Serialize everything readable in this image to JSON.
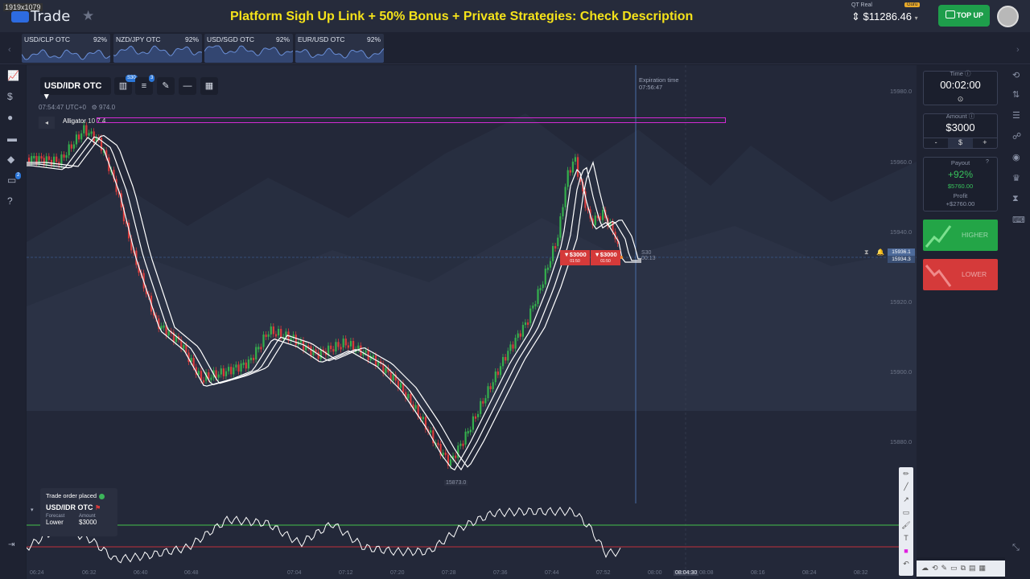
{
  "window": {
    "resolution_badge": "1919x1079"
  },
  "header": {
    "logo_text": "Trade",
    "promo_text": "Platform Sigh Up Link + 50% Bonus + Private Strategies: Check Description",
    "account_label": "QT Real",
    "account_badge": "Guru",
    "balance": "$11286.46",
    "top_up_label": "TOP UP"
  },
  "asset_tabs": [
    {
      "name": "USD/CLP OTC",
      "payout": "92%"
    },
    {
      "name": "NZD/JPY OTC",
      "payout": "92%"
    },
    {
      "name": "USD/SGD OTC",
      "payout": "92%"
    },
    {
      "name": "EUR/USD OTC",
      "payout": "92%"
    }
  ],
  "chart_toolbar": {
    "asset": "USD/IDR OTC",
    "timeframe_badge": "S30",
    "indicators_badge": "3",
    "server_time": "07:54:47 UTC+0",
    "spread": "974.0",
    "indicator_label": "Alligator",
    "indicator_params": "10 7 4"
  },
  "expiration": {
    "label": "Expiration time",
    "time": "07:56:47"
  },
  "y_axis_labels": [
    "15980.0",
    "15960.0",
    "15940.0",
    "15920.0",
    "15900.0",
    "15880.0"
  ],
  "price_tags": {
    "current": "15936.1",
    "second": "15934.3"
  },
  "open_orders": [
    {
      "amount": "▼$3000",
      "timer": "01:50"
    },
    {
      "amount": "▼$3000",
      "timer": "01:50"
    }
  ],
  "candle_timer": {
    "period": "S30",
    "remaining": "00:13"
  },
  "low_point_label": "15873.0",
  "notification": {
    "title": "Trade order placed",
    "asset": "USD/IDR OTC",
    "forecast_label": "Forecast",
    "amount_label": "Amount",
    "forecast": "Lower",
    "amount": "$3000"
  },
  "x_axis_labels": [
    "06:24",
    "06:32",
    "06:40",
    "06:48",
    "07:04",
    "07:12",
    "07:20",
    "07:28",
    "07:36",
    "07:44",
    "07:52",
    "08:00",
    "08:04:30",
    "08:08",
    "08:16",
    "08:24",
    "08:32"
  ],
  "right_panel": {
    "time_label": "Time",
    "time_value": "00:02:00",
    "amount_label": "Amount",
    "amount_value": "$3000",
    "minus": "-",
    "currency": "$",
    "plus": "+",
    "payout_label": "Payout",
    "payout_percent": "+92%",
    "payout_amount": "$5760.00",
    "profit_label": "Profit",
    "profit_amount": "+$2760.00",
    "higher_label": "HIGHER",
    "lower_label": "LOWER"
  },
  "colors": {
    "higher": "#23a547",
    "lower": "#d53a3a",
    "accent": "#2b76d8",
    "promo": "#f4e21a",
    "indicator_line": "#d32ad3"
  }
}
